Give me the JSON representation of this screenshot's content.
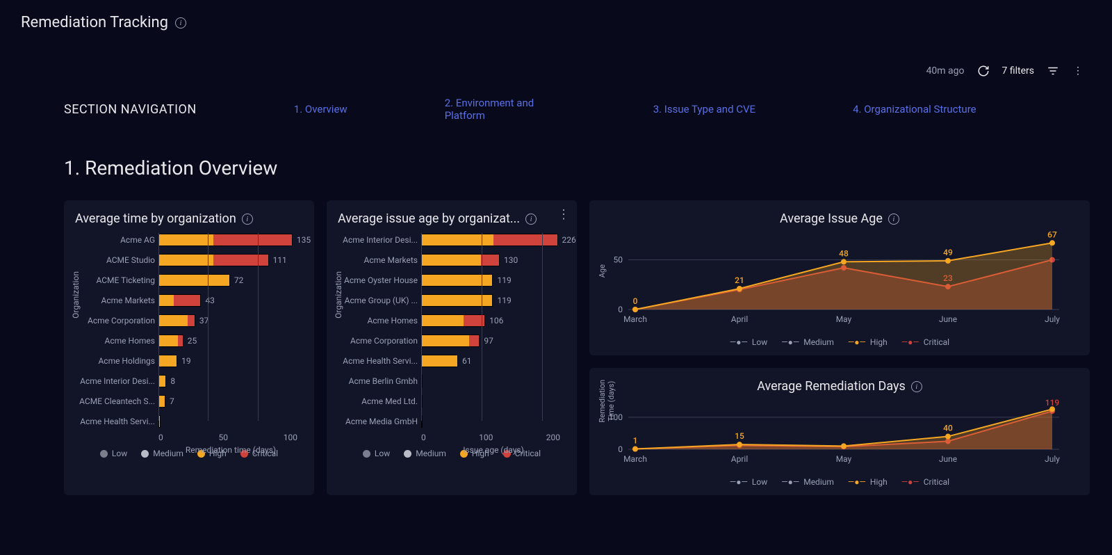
{
  "header": {
    "title": "Remediation Tracking"
  },
  "toolbar": {
    "age": "40m ago",
    "filters": "7 filters"
  },
  "nav": {
    "label": "SECTION NAVIGATION",
    "items": [
      "1. Overview",
      "2. Environment and Platform",
      "3. Issue Type and CVE",
      "4. Organizational Structure"
    ]
  },
  "section_title": "1. Remediation Overview",
  "legend": {
    "low": "Low",
    "medium": "Medium",
    "high": "High",
    "critical": "Critical"
  },
  "colors": {
    "low": "#7b7e8c",
    "medium": "#b9bcc7",
    "high": "#f5a623",
    "critical": "#d0423c"
  },
  "cards": {
    "bar1": {
      "title": "Average time by organization",
      "ylabel": "Organization",
      "xlabel": "Remediation time (days)"
    },
    "bar2": {
      "title": "Average issue age by organizat...",
      "ylabel": "Organization",
      "xlabel": "Issue age (days)"
    },
    "line1": {
      "title": "Average Issue Age",
      "ylabel": "Age"
    },
    "line2": {
      "title": "Average Remediation Days",
      "ylabel": "Remediation\nTime (days)"
    }
  },
  "chart_data": [
    {
      "id": "bar1",
      "type": "bar",
      "orientation": "horizontal",
      "xlabel": "Remediation time (days)",
      "ylabel": "Organization",
      "xticks": [
        0,
        50,
        100
      ],
      "xlim": [
        0,
        140
      ],
      "categories": [
        "Acme AG",
        "ACME Studio",
        "ACME Ticketing",
        "Acme Markets",
        "Acme Corporation",
        "Acme Homes",
        "Acme Holdings",
        "Acme Interior Desi...",
        "ACME Cleantech S...",
        "Acme Health Servi..."
      ],
      "series": [
        {
          "name": "High",
          "color": "#f5a623",
          "values": [
            55,
            55,
            72,
            15,
            30,
            20,
            19,
            8,
            7,
            2
          ]
        },
        {
          "name": "Critical",
          "color": "#d0423c",
          "values": [
            80,
            56,
            0,
            28,
            7,
            5,
            0,
            0,
            0,
            0
          ]
        }
      ],
      "totals": [
        135,
        111,
        72,
        43,
        37,
        25,
        19,
        8,
        7,
        null
      ]
    },
    {
      "id": "bar2",
      "type": "bar",
      "orientation": "horizontal",
      "xlabel": "Issue age (days)",
      "ylabel": "Organization",
      "xticks": [
        0,
        100,
        200
      ],
      "xlim": [
        0,
        230
      ],
      "categories": [
        "Acme Interior Desi...",
        "Acme Markets",
        "Acme Oyster House",
        "Acme Group (UK) ...",
        "Acme Homes",
        "Acme Corporation",
        "Acme Health Servi...",
        "Acme Berlin Gmbh",
        "Acme Med Ltd.",
        "Acme Media GmbH"
      ],
      "series": [
        {
          "name": "High",
          "color": "#f5a623",
          "values": [
            120,
            100,
            119,
            119,
            70,
            80,
            61,
            0,
            0,
            0
          ]
        },
        {
          "name": "Critical",
          "color": "#d0423c",
          "values": [
            106,
            30,
            0,
            0,
            36,
            17,
            0,
            0,
            0,
            0
          ]
        }
      ],
      "totals": [
        226,
        130,
        119,
        119,
        106,
        97,
        61,
        null,
        null,
        null
      ]
    },
    {
      "id": "line1",
      "type": "line",
      "x": [
        "March",
        "April",
        "May",
        "June",
        "July"
      ],
      "ylim": [
        0,
        70
      ],
      "yticks": [
        0,
        50
      ],
      "ylabel": "Age",
      "series": [
        {
          "name": "High",
          "color": "#f5a623",
          "values": [
            0,
            21,
            48,
            49,
            67
          ],
          "labels": [
            "0",
            "21",
            "48",
            "49",
            "67"
          ]
        },
        {
          "name": "Critical",
          "color": "#d0423c",
          "values": [
            0,
            20,
            42,
            23,
            50
          ],
          "labels": [
            null,
            null,
            null,
            "23",
            null
          ]
        }
      ]
    },
    {
      "id": "line2",
      "type": "line",
      "x": [
        "March",
        "April",
        "May",
        "June",
        "July"
      ],
      "ylim": [
        0,
        130
      ],
      "yticks": [
        0,
        100
      ],
      "ylabel": "Remediation Time (days)",
      "series": [
        {
          "name": "High",
          "color": "#f5a623",
          "values": [
            1,
            15,
            10,
            40,
            125
          ],
          "labels": [
            "1",
            "15",
            null,
            "40",
            null
          ]
        },
        {
          "name": "Critical",
          "color": "#d0423c",
          "values": [
            1,
            12,
            8,
            25,
            119
          ],
          "labels": [
            null,
            null,
            null,
            null,
            "119"
          ]
        }
      ]
    }
  ]
}
